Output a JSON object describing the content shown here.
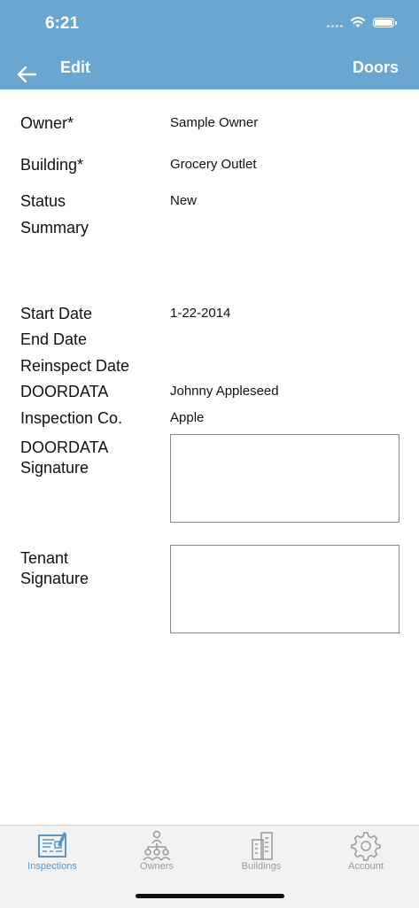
{
  "status_bar": {
    "time": "6:21"
  },
  "nav": {
    "title": "Edit",
    "right": "Doors"
  },
  "form": {
    "owner_label": "Owner*",
    "owner_value": "Sample Owner",
    "building_label": "Building*",
    "building_value": "Grocery Outlet",
    "status_label": "Status",
    "status_value": "New",
    "summary_label": "Summary",
    "start_label": "Start Date",
    "start_value": "1-22-2014",
    "end_label": "End Date",
    "reinspect_label": "Reinspect Date",
    "doordata_label": "DOORDATA",
    "doordata_value": "Johnny Appleseed",
    "inspco_label": "Inspection Co.",
    "inspco_value": "Apple",
    "doordata_sig_label_1": "DOORDATA",
    "doordata_sig_label_2": "Signature",
    "tenant_sig_label_1": "Tenant",
    "tenant_sig_label_2": "Signature"
  },
  "tabs": [
    {
      "label": "Inspections",
      "icon": "inspections-icon",
      "active": true
    },
    {
      "label": "Owners",
      "icon": "owners-icon",
      "active": false
    },
    {
      "label": "Buildings",
      "icon": "buildings-icon",
      "active": false
    },
    {
      "label": "Account",
      "icon": "gear-icon",
      "active": false
    }
  ],
  "colors": {
    "header": "#6aa6cf",
    "active_tab": "#5b95c6",
    "inactive_tab": "#9a9a9a"
  }
}
